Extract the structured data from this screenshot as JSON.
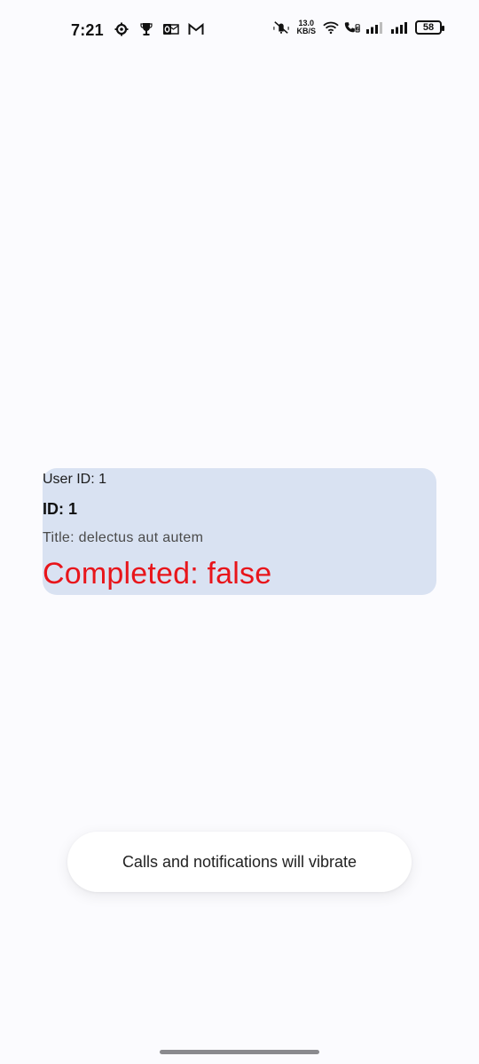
{
  "status_bar": {
    "time": "7:21",
    "netspeed_value": "13.0",
    "netspeed_unit": "KB/S",
    "battery_level": "58",
    "left_icons": [
      "settings-gear-icon",
      "trophy-icon",
      "outlook-icon",
      "gmail-icon"
    ],
    "right_icons": [
      "vibrate-mute-icon",
      "wifi-icon",
      "wifi-calling-icon",
      "signal-icon-1",
      "signal-icon-2",
      "battery-icon"
    ]
  },
  "todo": {
    "user_id": "User ID: 1",
    "id": "ID: 1",
    "title": "Title: delectus aut autem",
    "completed": "Completed: false"
  },
  "toast": {
    "message": "Calls and notifications will vibrate"
  },
  "colors": {
    "background": "#fbfbfe",
    "card_background": "#d9e2f2",
    "completed_text": "#e8151b"
  }
}
